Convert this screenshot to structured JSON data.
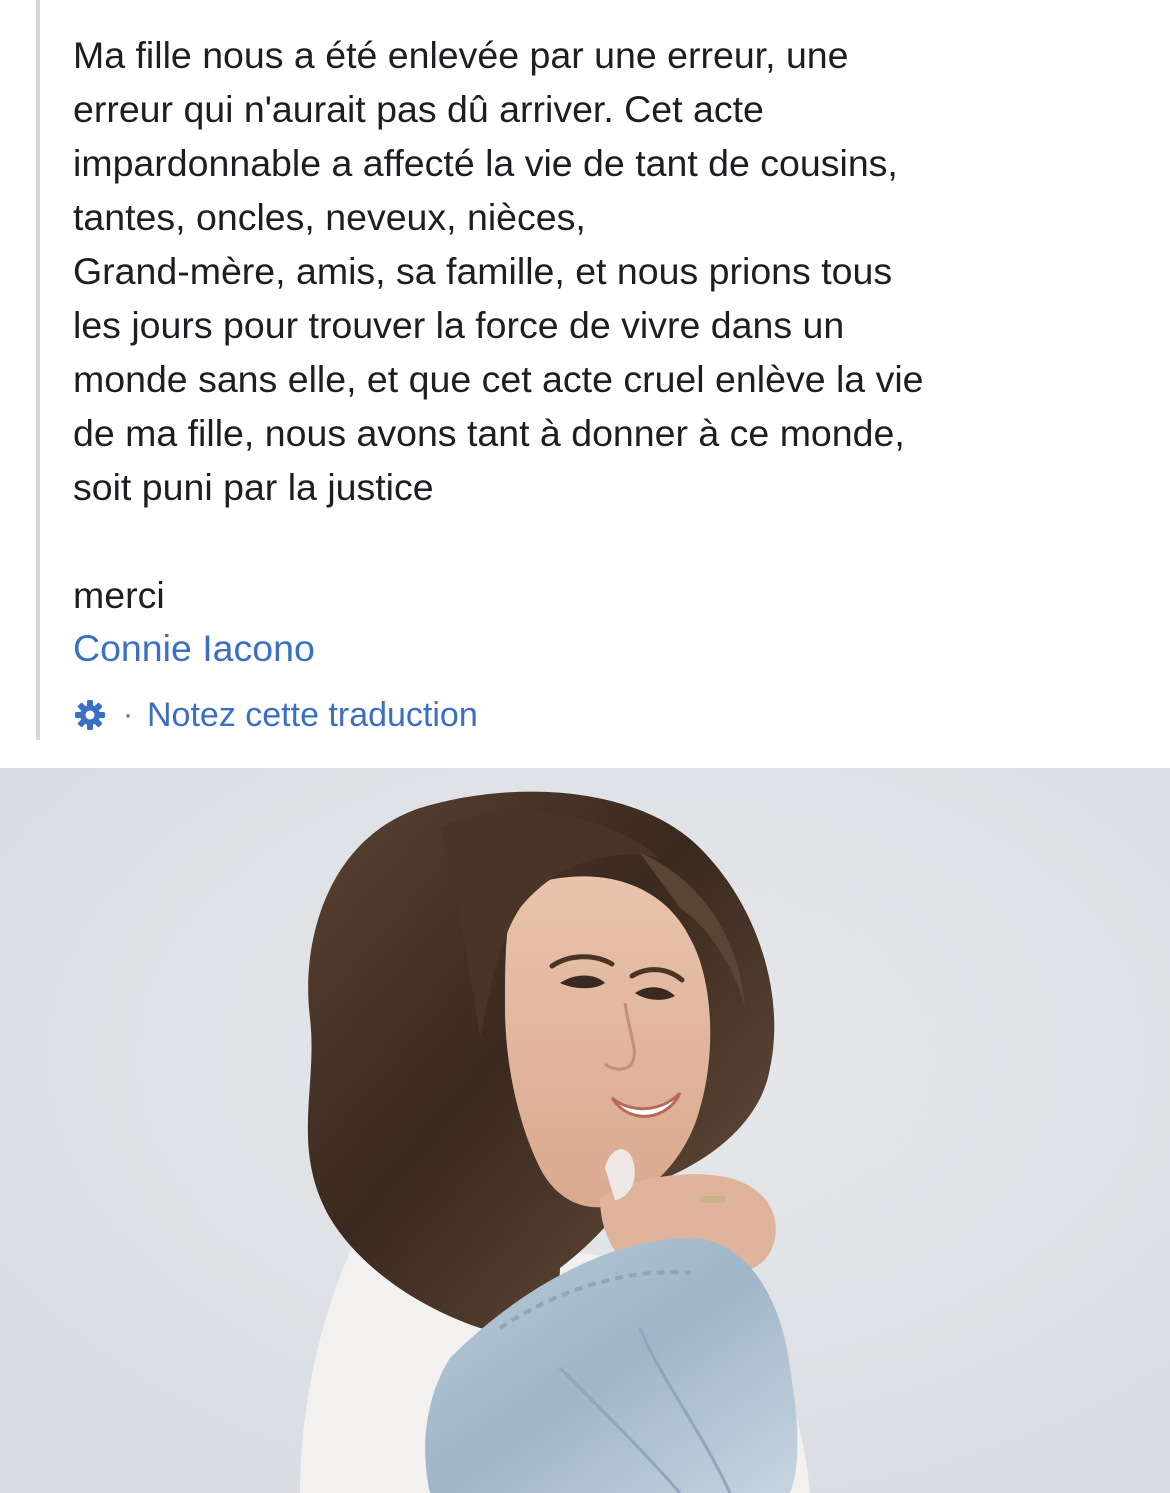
{
  "post": {
    "body": "Ma fille nous a été enlevée par une erreur, une\nerreur qui n'aurait pas dû arriver. Cet acte\nimpardonnable a affecté la vie de tant de cousins,\ntantes, oncles, neveux, nièces,\nGrand-mère, amis, sa famille, et nous prions tous\nles jours pour trouver la force de vivre dans un\nmonde sans elle, et que cet acte cruel enlève la vie\nde ma fille, nous avons tant à donner à ce monde,\nsoit puni par la justice",
    "signoff": "merci",
    "author": "Connie Iacono"
  },
  "translation": {
    "icon": "gear-icon",
    "separator": "·",
    "rate_label": "Notez cette traduction"
  },
  "colors": {
    "text": "#1c1e21",
    "link": "#3b6fc4",
    "quote_bar": "#d7d8dc",
    "photo_background": "#e1e3e7"
  }
}
